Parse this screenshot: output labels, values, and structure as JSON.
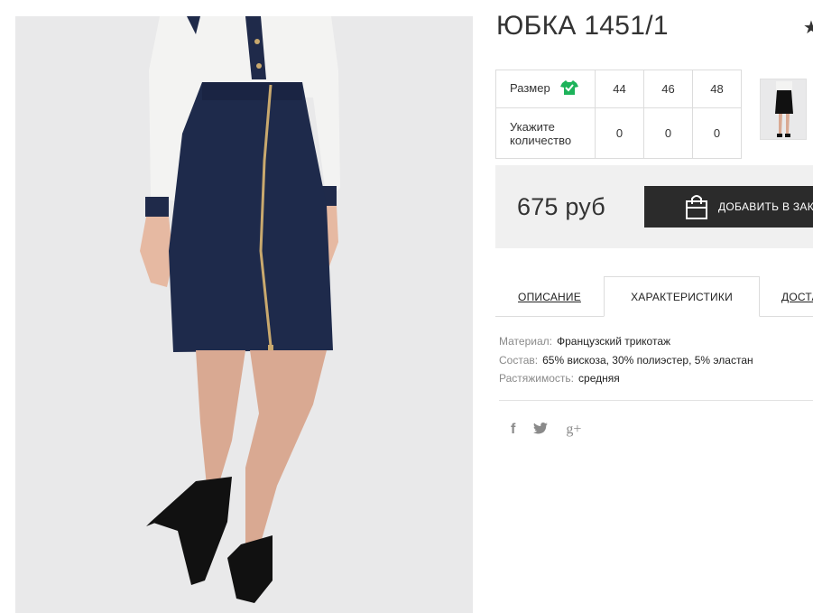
{
  "product": {
    "title": "ЮБКА 1451/1",
    "star_icon": "star-icon"
  },
  "size_table": {
    "size_label": "Размер",
    "size_icon": "shirt-check-icon",
    "size_icon_color": "#1db35a",
    "sizes": [
      "44",
      "46",
      "48"
    ],
    "qty_label": "Укажите количество",
    "quantities": [
      "0",
      "0",
      "0"
    ]
  },
  "price_panel": {
    "price": "675 руб",
    "add_to_cart_label": "ДОБАВИТЬ В ЗАКАЗ",
    "cart_icon": "shopping-bag-icon",
    "button_color": "#2b2b2b"
  },
  "tabs": [
    {
      "label": "ОПИСАНИЕ",
      "active": false
    },
    {
      "label": "ХАРАКТЕРИСТИКИ",
      "active": true
    },
    {
      "label": "ДОСТАВКА",
      "active": false
    }
  ],
  "characteristics": [
    {
      "key": "Материал:",
      "value": "Французский трикотаж"
    },
    {
      "key": "Состав:",
      "value": "65% вискоза, 30% полиэстер, 5% эластан"
    },
    {
      "key": "Растяжимость:",
      "value": "средняя"
    }
  ],
  "social": {
    "facebook": "f",
    "twitter_icon": "twitter-icon",
    "googleplus": "g+"
  }
}
